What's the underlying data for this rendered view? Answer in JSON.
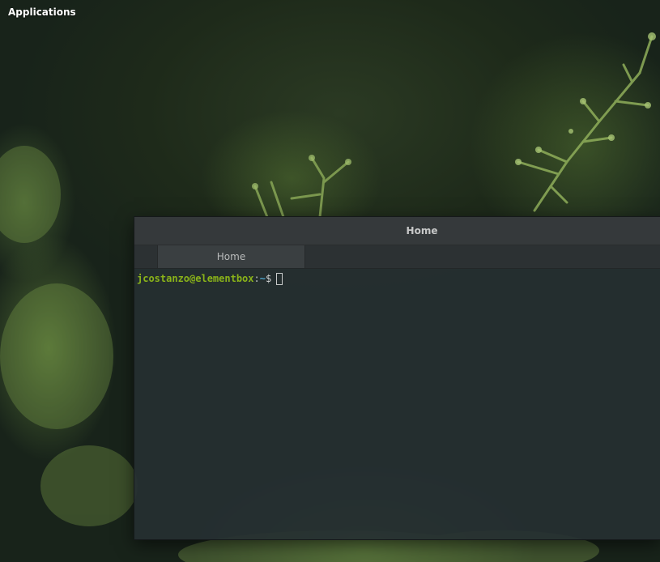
{
  "desktop": {
    "panel": {
      "applications_label": "Applications"
    }
  },
  "terminal": {
    "window_title": "Home",
    "tabs": [
      {
        "label": "Home",
        "active": true
      }
    ],
    "prompt": {
      "user_host": "jcostanzo@elementbox",
      "separator": ":",
      "path": "~",
      "symbol": "$"
    },
    "colors": {
      "user_host": "#8ab319",
      "path": "#4fa3c7",
      "background": "#262f32"
    }
  }
}
